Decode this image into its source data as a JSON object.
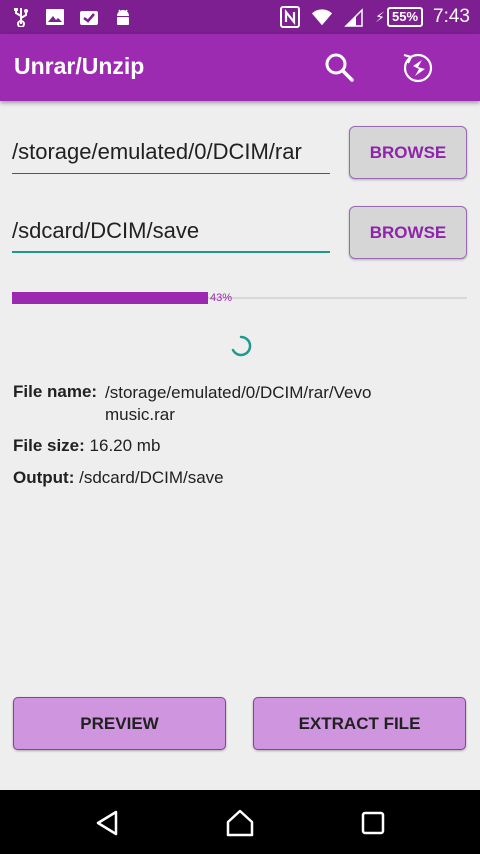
{
  "status_bar": {
    "battery": "55%",
    "time": "7:43"
  },
  "app_bar": {
    "title": "Unrar/Unzip"
  },
  "source": {
    "path_value": "/storage/emulated/0/DCIM/rar",
    "browse_label": "BROWSE"
  },
  "destination": {
    "path_value": "/sdcard/DCIM/save",
    "browse_label": "BROWSE"
  },
  "progress": {
    "value": 0.43,
    "label": "43%"
  },
  "file_info": {
    "name_label": "File name:",
    "name_value": "/storage/emulated/0/DCIM/rar/Vevo music.rar",
    "size_label": "File size:",
    "size_value": "16.20 mb",
    "output_label": "Output:",
    "output_value": "/sdcard/DCIM/save"
  },
  "actions": {
    "preview_label": "PREVIEW",
    "extract_label": "EXTRACT FILE"
  },
  "colors": {
    "status_bar": "#7d1f91",
    "app_bar": "#9d2bb2",
    "accent": "#9c27b0",
    "focus_underline": "#1e9a8d",
    "action_button": "#cf95de"
  }
}
